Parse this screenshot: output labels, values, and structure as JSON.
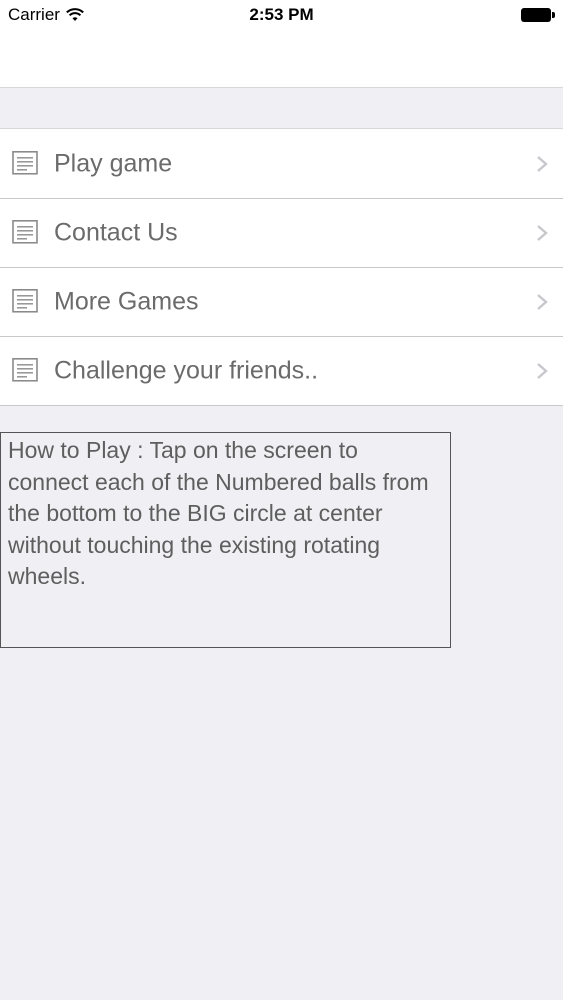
{
  "status_bar": {
    "carrier": "Carrier",
    "time": "2:53 PM"
  },
  "menu": {
    "items": [
      {
        "label": "Play game",
        "icon": "document-icon"
      },
      {
        "label": "Contact Us",
        "icon": "document-icon"
      },
      {
        "label": "More Games",
        "icon": "document-icon"
      },
      {
        "label": "Challenge your friends..",
        "icon": "document-icon"
      }
    ]
  },
  "instructions": {
    "text": "How to Play : Tap on the screen to connect each of the Numbered balls from the bottom to the BIG circle at center without touching the existing rotating wheels."
  },
  "colors": {
    "background": "#efeff4",
    "cell": "#ffffff",
    "label": "#6b6b6b",
    "chevron": "#c7c7cc"
  }
}
